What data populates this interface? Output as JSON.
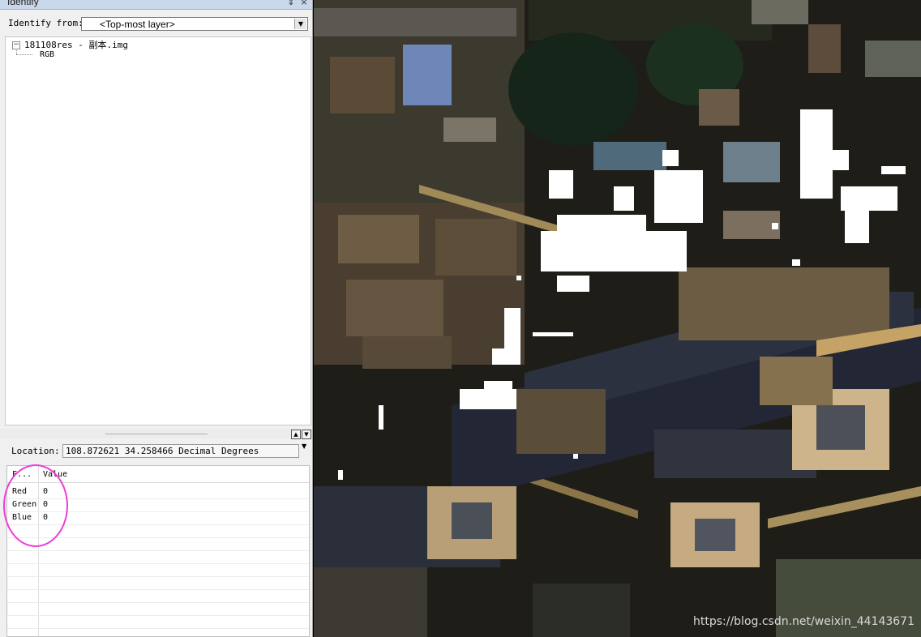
{
  "window": {
    "title": "Identify",
    "pin_glyph": "⇕",
    "close_glyph": "×"
  },
  "identify_from": {
    "label": "Identify from:",
    "selected": "<Top-most layer>"
  },
  "tree": {
    "expander": "−",
    "root_label": "181108res - 副本.img",
    "child_label": "RGB"
  },
  "location": {
    "label": "Location:",
    "value": "108.872621  34.258466 Decimal Degrees",
    "menu_glyph": "▼"
  },
  "results_table": {
    "columns": [
      "F...",
      "Value"
    ],
    "rows": [
      {
        "field": "Red",
        "value": "0"
      },
      {
        "field": "Green",
        "value": "0"
      },
      {
        "field": "Blue",
        "value": "0"
      }
    ]
  },
  "annotation_color": "#ee3bd8",
  "watermark": "https://blog.csdn.net/weixin_44143671"
}
